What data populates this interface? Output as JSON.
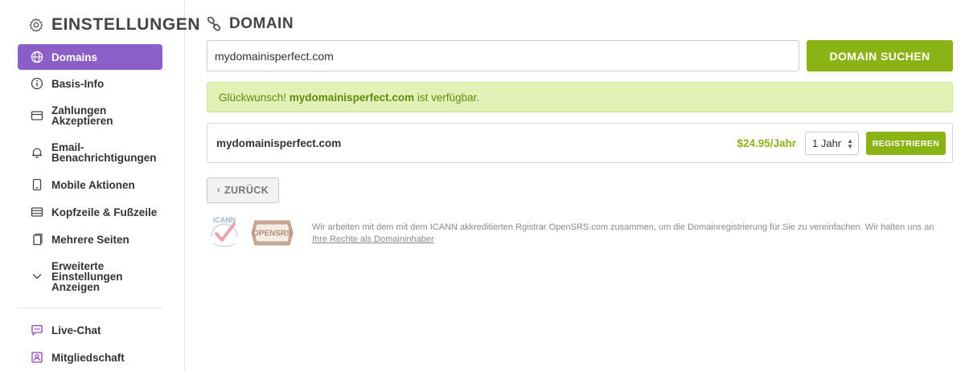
{
  "sidebar": {
    "title": "EINSTELLUNGEN",
    "items": [
      {
        "label": "Domains",
        "icon": "globe-icon"
      },
      {
        "label": "Basis-Info",
        "icon": "info-icon"
      },
      {
        "label": "Zahlungen Akzeptieren",
        "icon": "wallet-icon"
      },
      {
        "label": "Email-Benachrichtigungen",
        "icon": "bell-icon"
      },
      {
        "label": "Mobile Aktionen",
        "icon": "mobile-icon"
      },
      {
        "label": "Kopfzeile & Fußzeile",
        "icon": "layout-icon"
      },
      {
        "label": "Mehrere Seiten",
        "icon": "pages-icon"
      },
      {
        "label": "Erweiterte Einstellungen Anzeigen",
        "icon": "chevron-down-icon"
      }
    ],
    "extra_items": [
      {
        "label": "Live-Chat",
        "icon": "chat-icon"
      },
      {
        "label": "Mitgliedschaft",
        "icon": "member-icon"
      }
    ]
  },
  "main": {
    "title": "DOMAIN",
    "search": {
      "value": "mydomainisperfect.com",
      "button_label": "DOMAIN SUCHEN"
    },
    "banner": {
      "prefix": "Glückwunsch! ",
      "domain": "mydomainisperfect.com",
      "suffix": " ist verfügbar."
    },
    "result": {
      "domain": "mydomainisperfect.com",
      "price": "$24.95/Jahr",
      "term": "1 Jahr",
      "register_label": "REGISTRIEREN"
    },
    "back_label": "ZURÜCK",
    "logos": {
      "icann": "ICANN",
      "opensrs": "OPENSRS"
    },
    "disclaimer": "Wir arbeiten mit dem mit dem ICANN akkreditierten Rgistrar OpenSRS.com zusammen, um die Domainregistrierung für Sie zu vereinfachen. Wir halten uns an",
    "rights_link": "Ihre Rechte als Domaininhaber"
  },
  "colors": {
    "accent_purple": "#8b5fc7",
    "accent_green": "#8ab316",
    "success_bg": "#e2f1b6"
  }
}
